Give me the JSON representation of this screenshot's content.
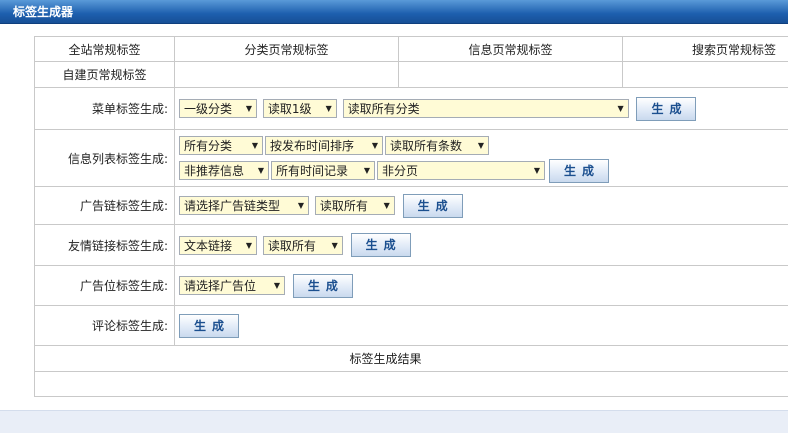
{
  "window": {
    "title": "标签生成器"
  },
  "tabs": [
    "全站常规标签",
    "分类页常规标签",
    "信息页常规标签",
    "搜索页常规标签",
    "自建页常规标签",
    "",
    "",
    ""
  ],
  "rows": {
    "menu": {
      "label": "菜单标签生成:",
      "sel1": "一级分类",
      "sel2": "读取1级",
      "sel3": "读取所有分类",
      "button": "生成"
    },
    "infolist": {
      "label": "信息列表标签生成:",
      "sel1": "所有分类",
      "sel2": "按发布时间排序",
      "sel3": "读取所有条数",
      "sel4": "非推荐信息",
      "sel5": "所有时间记录",
      "sel6": "非分页",
      "button": "生成"
    },
    "adchain": {
      "label": "广告链标签生成:",
      "sel1": "请选择广告链类型",
      "sel2": "读取所有",
      "button": "生成"
    },
    "friendlink": {
      "label": "友情链接标签生成:",
      "sel1": "文本链接",
      "sel2": "读取所有",
      "button": "生成"
    },
    "adslot": {
      "label": "广告位标签生成:",
      "sel1": "请选择广告位",
      "button": "生成"
    },
    "comment": {
      "label": "评论标签生成:",
      "button": "生成"
    }
  },
  "result": {
    "title": "标签生成结果"
  }
}
